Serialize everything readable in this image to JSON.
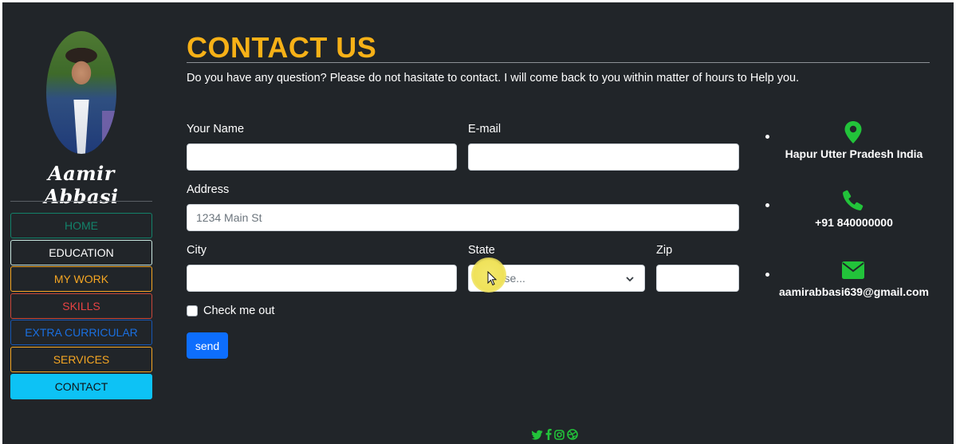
{
  "sidebar": {
    "name": "Aamir Abbasi",
    "nav": [
      {
        "label": "HOME",
        "color": "#13826a"
      },
      {
        "label": "EDUCATION",
        "color": "#ffffff"
      },
      {
        "label": "MY WORK",
        "color": "#f5a623"
      },
      {
        "label": "SKILLS",
        "color": "#e84343"
      },
      {
        "label": "EXTRA CURRICULAR",
        "color": "#1a6fe0"
      },
      {
        "label": "SERVICES",
        "color": "#f5a623"
      },
      {
        "label": "CONTACT",
        "color": "#0dc2f5",
        "active": true
      }
    ]
  },
  "main": {
    "title": "CONTACT US",
    "intro": "Do you have any question? Please do not hasitate to contact. I will come back to you within matter of hours to Help you."
  },
  "form": {
    "name_label": "Your Name",
    "email_label": "E-mail",
    "address_label": "Address",
    "address_placeholder": "1234 Main St",
    "city_label": "City",
    "state_label": "State",
    "state_selected": "Choose...",
    "zip_label": "Zip",
    "check_label": "Check me out",
    "submit_label": "send"
  },
  "contact_info": {
    "location": "Hapur Utter Pradesh India",
    "phone": "+91 840000000",
    "email": "aamirabbasi639@gmail.com"
  },
  "colors": {
    "background": "#212529",
    "accent": "#f7b117",
    "icon_green": "#22c33a",
    "primary": "#0d6efd"
  },
  "social_icons": [
    "twitter-icon",
    "facebook-icon",
    "instagram-icon",
    "dribbble-icon"
  ]
}
